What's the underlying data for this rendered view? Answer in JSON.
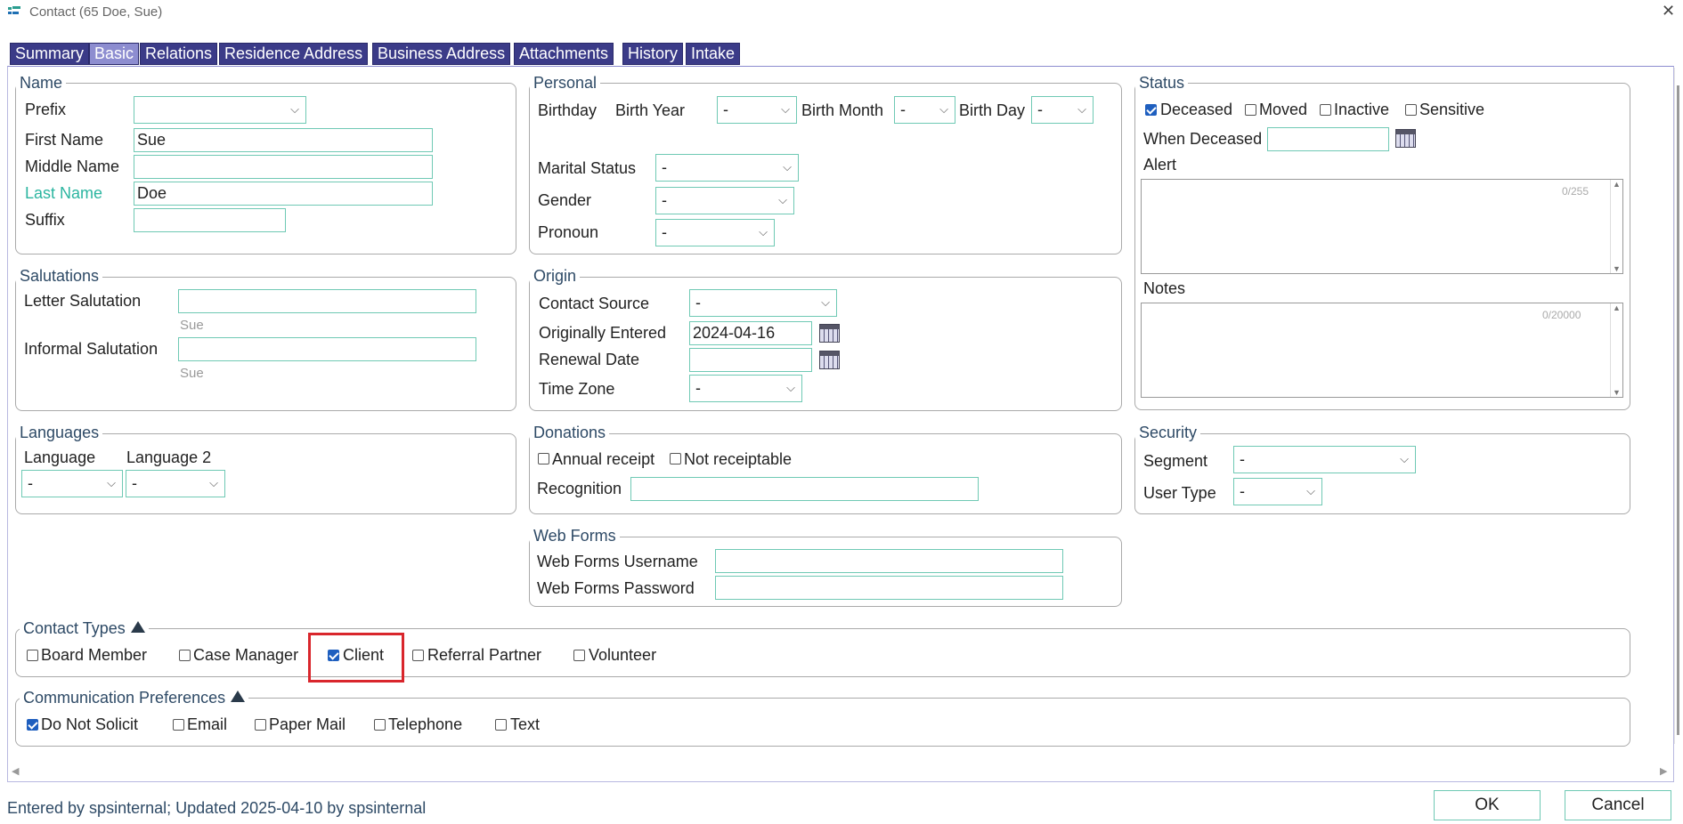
{
  "window": {
    "title": "Contact (65   Doe, Sue)",
    "close": "✕"
  },
  "tabs": [
    "Summary",
    "Basic",
    "Relations",
    "Residence Address",
    "Business Address",
    "Attachments",
    "History",
    "Intake"
  ],
  "name": {
    "legend": "Name",
    "prefix_label": "Prefix",
    "prefix_value": "",
    "first_label": "First Name",
    "first_value": "Sue",
    "middle_label": "Middle Name",
    "middle_value": "",
    "last_label": "Last Name",
    "last_value": "Doe",
    "suffix_label": "Suffix",
    "suffix_value": "",
    "last_label_color": "#2bb5a0"
  },
  "personal": {
    "legend": "Personal",
    "birthday_label": "Birthday",
    "birth_year_label": "Birth Year",
    "birth_year": "-",
    "birth_month_label": "Birth Month",
    "birth_month": "-",
    "birth_day_label": "Birth Day",
    "birth_day": "-",
    "marital_label": "Marital Status",
    "marital": "-",
    "gender_label": "Gender",
    "gender": "-",
    "pronoun_label": "Pronoun",
    "pronoun": "-"
  },
  "status": {
    "legend": "Status",
    "deceased": "Deceased",
    "moved": "Moved",
    "inactive": "Inactive",
    "sensitive": "Sensitive",
    "when_deceased_label": "When Deceased",
    "when_deceased": "",
    "alert_label": "Alert",
    "alert_counter": "0/255",
    "notes_label": "Notes",
    "notes_counter": "0/20000"
  },
  "salutations": {
    "legend": "Salutations",
    "letter_label": "Letter Salutation",
    "letter_value": "",
    "letter_hint": "Sue",
    "informal_label": "Informal Salutation",
    "informal_value": "",
    "informal_hint": "Sue"
  },
  "origin": {
    "legend": "Origin",
    "source_label": "Contact Source",
    "source": "-",
    "entered_label": "Originally Entered",
    "entered": "2024-04-16",
    "renewal_label": "Renewal Date",
    "renewal": "",
    "tz_label": "Time Zone",
    "tz": "-"
  },
  "languages": {
    "legend": "Languages",
    "lang1_label": "Language",
    "lang1": "-",
    "lang2_label": "Language 2",
    "lang2": "-"
  },
  "donations": {
    "legend": "Donations",
    "annual": "Annual receipt",
    "not_receiptable": "Not receiptable",
    "recognition_label": "Recognition",
    "recognition": ""
  },
  "security": {
    "legend": "Security",
    "segment_label": "Segment",
    "segment": "-",
    "user_type_label": "User Type",
    "user_type": "-"
  },
  "webforms": {
    "legend": "Web Forms",
    "username_label": "Web Forms Username",
    "username": "",
    "password_label": "Web Forms Password",
    "password": ""
  },
  "contact_types": {
    "legend": "Contact Types",
    "items": [
      "Board Member",
      "Case Manager",
      "Client",
      "Referral Partner",
      "Volunteer"
    ]
  },
  "comm_prefs": {
    "legend": "Communication Preferences",
    "items": [
      "Do Not Solicit",
      "Email",
      "Paper Mail",
      "Telephone",
      "Text"
    ]
  },
  "footer": {
    "status": "Entered by spsinternal; Updated 2025-04-10 by spsinternal",
    "ok": "OK",
    "cancel": "Cancel"
  },
  "colors": {
    "tab_bg": "#3b3b88",
    "tab_active": "#8d8dd0",
    "field_border": "#6fc9b4",
    "check_blue": "#1f5fbf",
    "highlight": "#d9262c"
  }
}
